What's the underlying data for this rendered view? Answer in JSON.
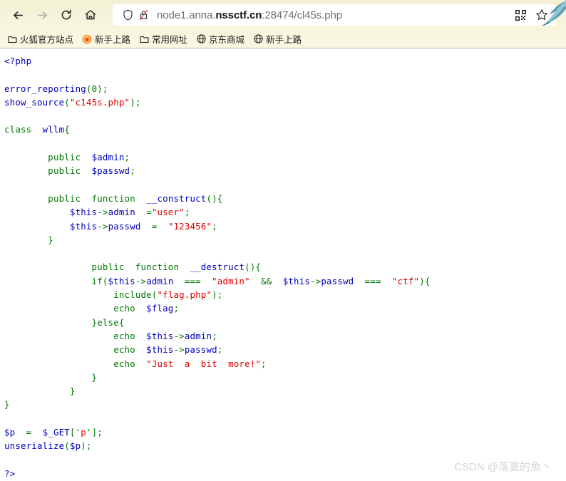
{
  "browser": {
    "nav": {
      "back_icon": "arrow-left-icon",
      "forward_icon": "arrow-right-icon",
      "reload_icon": "reload-icon",
      "home_icon": "home-icon",
      "back_title": "Back",
      "forward_title": "Forward",
      "reload_title": "Reload",
      "home_title": "Home"
    },
    "urlbar": {
      "url_prefix": "node1.anna.",
      "url_host_strong": "nssctf.cn",
      "url_suffix": ":28474/cl45s.php",
      "full_url": "node1.anna.nssctf.cn:28474/cl45s.php",
      "shield_icon": "shield-icon",
      "lock_broken_icon": "lock-slashed-icon",
      "qr_icon": "qr-code-icon",
      "star_icon": "star-bookmark-icon",
      "qr_title": "QR code",
      "star_title": "Bookmark this page"
    },
    "bookmarks": [
      {
        "label": "火狐官方站点",
        "icon": "folder-icon"
      },
      {
        "label": "新手上路",
        "icon": "firefox-icon"
      },
      {
        "label": "常用网址",
        "icon": "folder-icon"
      },
      {
        "label": "京东商城",
        "icon": "globe-icon"
      },
      {
        "label": "新手上路",
        "icon": "globe-icon"
      }
    ]
  },
  "page": {
    "watermark": "CSDN @落寞的魚丶",
    "background": "#ffffff",
    "colors": {
      "keyword": "#007700",
      "variable": "#0000bb",
      "string": "#dd0000",
      "default": "#0000bb"
    },
    "source_lines": [
      [
        {
          "t": "<?php",
          "c": "v"
        }
      ],
      [
        {
          "t": "",
          "c": "d"
        }
      ],
      [
        {
          "t": "error_reporting",
          "c": "v"
        },
        {
          "t": "(0)",
          "c": "k"
        },
        {
          "t": ";",
          "c": "k"
        }
      ],
      [
        {
          "t": "show_source",
          "c": "v"
        },
        {
          "t": "(",
          "c": "k"
        },
        {
          "t": "\"c145s.php\"",
          "c": "s"
        },
        {
          "t": ");",
          "c": "k"
        }
      ],
      [
        {
          "t": "",
          "c": "d"
        }
      ],
      [
        {
          "t": "class",
          "c": "k"
        },
        {
          "t": "  ",
          "c": "d"
        },
        {
          "t": "wllm",
          "c": "v"
        },
        {
          "t": "{",
          "c": "k"
        }
      ],
      [
        {
          "t": "",
          "c": "d"
        }
      ],
      [
        {
          "t": "        public",
          "c": "k"
        },
        {
          "t": "  ",
          "c": "d"
        },
        {
          "t": "$admin",
          "c": "v"
        },
        {
          "t": ";",
          "c": "k"
        }
      ],
      [
        {
          "t": "        public",
          "c": "k"
        },
        {
          "t": "  ",
          "c": "d"
        },
        {
          "t": "$passwd",
          "c": "v"
        },
        {
          "t": ";",
          "c": "k"
        }
      ],
      [
        {
          "t": "",
          "c": "d"
        }
      ],
      [
        {
          "t": "        public",
          "c": "k"
        },
        {
          "t": "  ",
          "c": "d"
        },
        {
          "t": "function",
          "c": "k"
        },
        {
          "t": "  ",
          "c": "d"
        },
        {
          "t": "__construct",
          "c": "v"
        },
        {
          "t": "(){",
          "c": "k"
        }
      ],
      [
        {
          "t": "            ",
          "c": "d"
        },
        {
          "t": "$this",
          "c": "v"
        },
        {
          "t": "->",
          "c": "k"
        },
        {
          "t": "admin",
          "c": "v"
        },
        {
          "t": "  =",
          "c": "k"
        },
        {
          "t": "\"user\"",
          "c": "s"
        },
        {
          "t": ";",
          "c": "k"
        }
      ],
      [
        {
          "t": "            ",
          "c": "d"
        },
        {
          "t": "$this",
          "c": "v"
        },
        {
          "t": "->",
          "c": "k"
        },
        {
          "t": "passwd",
          "c": "v"
        },
        {
          "t": "  =  ",
          "c": "k"
        },
        {
          "t": "\"123456\"",
          "c": "s"
        },
        {
          "t": ";",
          "c": "k"
        }
      ],
      [
        {
          "t": "        }",
          "c": "k"
        }
      ],
      [
        {
          "t": "",
          "c": "d"
        }
      ],
      [
        {
          "t": "                public",
          "c": "k"
        },
        {
          "t": "  ",
          "c": "d"
        },
        {
          "t": "function",
          "c": "k"
        },
        {
          "t": "  ",
          "c": "d"
        },
        {
          "t": "__destruct",
          "c": "v"
        },
        {
          "t": "(){",
          "c": "k"
        }
      ],
      [
        {
          "t": "                if(",
          "c": "k"
        },
        {
          "t": "$this",
          "c": "v"
        },
        {
          "t": "->",
          "c": "k"
        },
        {
          "t": "admin",
          "c": "v"
        },
        {
          "t": "  ===  ",
          "c": "k"
        },
        {
          "t": "\"admin\"",
          "c": "s"
        },
        {
          "t": "  &&  ",
          "c": "k"
        },
        {
          "t": "$this",
          "c": "v"
        },
        {
          "t": "->",
          "c": "k"
        },
        {
          "t": "passwd",
          "c": "v"
        },
        {
          "t": "  ===  ",
          "c": "k"
        },
        {
          "t": "\"ctf\"",
          "c": "s"
        },
        {
          "t": "){",
          "c": "k"
        }
      ],
      [
        {
          "t": "                    include",
          "c": "k"
        },
        {
          "t": "(",
          "c": "k"
        },
        {
          "t": "\"flag.php\"",
          "c": "s"
        },
        {
          "t": ");",
          "c": "k"
        }
      ],
      [
        {
          "t": "                    echo",
          "c": "k"
        },
        {
          "t": "  ",
          "c": "d"
        },
        {
          "t": "$flag",
          "c": "v"
        },
        {
          "t": ";",
          "c": "k"
        }
      ],
      [
        {
          "t": "                }else{",
          "c": "k"
        }
      ],
      [
        {
          "t": "                    echo",
          "c": "k"
        },
        {
          "t": "  ",
          "c": "d"
        },
        {
          "t": "$this",
          "c": "v"
        },
        {
          "t": "->",
          "c": "k"
        },
        {
          "t": "admin",
          "c": "v"
        },
        {
          "t": ";",
          "c": "k"
        }
      ],
      [
        {
          "t": "                    echo",
          "c": "k"
        },
        {
          "t": "  ",
          "c": "d"
        },
        {
          "t": "$this",
          "c": "v"
        },
        {
          "t": "->",
          "c": "k"
        },
        {
          "t": "passwd",
          "c": "v"
        },
        {
          "t": ";",
          "c": "k"
        }
      ],
      [
        {
          "t": "                    echo",
          "c": "k"
        },
        {
          "t": "  ",
          "c": "d"
        },
        {
          "t": "\"Just  a  bit  more!\"",
          "c": "s"
        },
        {
          "t": ";",
          "c": "k"
        }
      ],
      [
        {
          "t": "                }",
          "c": "k"
        }
      ],
      [
        {
          "t": "            }",
          "c": "k"
        }
      ],
      [
        {
          "t": "}",
          "c": "k"
        }
      ],
      [
        {
          "t": "",
          "c": "d"
        }
      ],
      [
        {
          "t": "$p",
          "c": "v"
        },
        {
          "t": "  =  ",
          "c": "k"
        },
        {
          "t": "$_GET",
          "c": "v"
        },
        {
          "t": "['",
          "c": "k"
        },
        {
          "t": "p",
          "c": "s"
        },
        {
          "t": "'];",
          "c": "k"
        }
      ],
      [
        {
          "t": "unserialize",
          "c": "v"
        },
        {
          "t": "(",
          "c": "k"
        },
        {
          "t": "$p",
          "c": "v"
        },
        {
          "t": ");",
          "c": "k"
        }
      ],
      [
        {
          "t": "",
          "c": "d"
        }
      ],
      [
        {
          "t": "?>",
          "c": "v"
        }
      ]
    ]
  }
}
